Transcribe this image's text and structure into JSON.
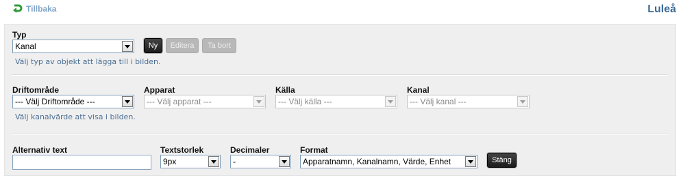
{
  "header": {
    "back_label": "Tillbaka",
    "site_name": "Luleå"
  },
  "object_section": {
    "type_label": "Typ",
    "type_value": "Kanal",
    "buttons": {
      "new": "Ny",
      "edit": "Editera",
      "delete": "Ta bort"
    },
    "hint": "Välj typ av objekt att lägga till i bilden."
  },
  "channel_section": {
    "area_label": "Driftområde",
    "area_value": "--- Välj Driftområde ---",
    "device_label": "Apparat",
    "device_value": "--- Välj apparat ---",
    "source_label": "Källa",
    "source_value": "--- Välj källa ---",
    "channel_label": "Kanal",
    "channel_value": "--- Välj kanal ---",
    "hint": "Välj kanalvärde att visa i bilden."
  },
  "format_section": {
    "alt_text_label": "Alternativ text",
    "alt_text_value": "",
    "text_size_label": "Textstorlek",
    "text_size_value": "9px",
    "decimals_label": "Decimaler",
    "decimals_value": "-",
    "format_label": "Format",
    "format_value": "Apparatnamn, Kanalnamn, Värde, Enhet",
    "close_button": "Stäng"
  },
  "colors": {
    "accent": "#3c6b96",
    "hint": "#4b6f94",
    "back_icon": "#2e9c3a",
    "panel_bg": "#efefef"
  }
}
